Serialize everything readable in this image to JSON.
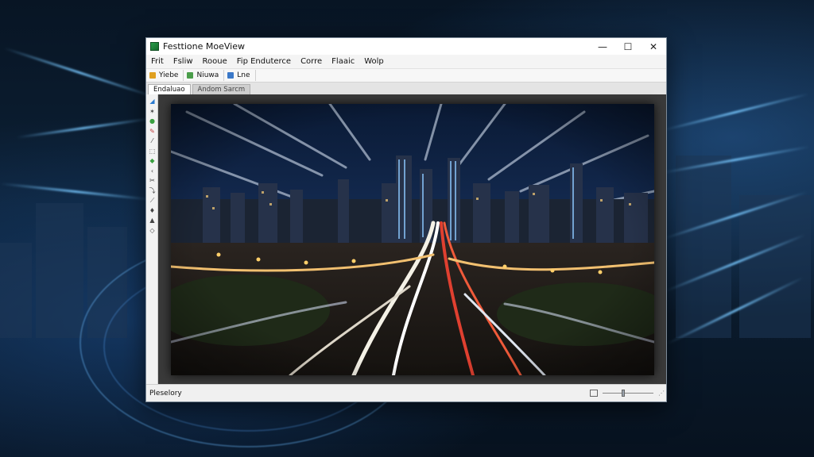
{
  "window": {
    "title": "Festtione MoeView",
    "controls": {
      "minimize": "—",
      "maximize": "☐",
      "close": "✕"
    }
  },
  "menu": [
    "Frit",
    "Fsliw",
    "Rooue",
    "Fip Enduterce",
    "Corre",
    "Flaaic",
    "Wolp"
  ],
  "toolbar": [
    {
      "label": "Yiebe",
      "icon": "folder-icon",
      "color": "#e0a020"
    },
    {
      "label": "Niuwa",
      "icon": "image-icon",
      "color": "#4a9d4a"
    },
    {
      "label": "Lne",
      "icon": "link-icon",
      "color": "#3a78c8"
    }
  ],
  "tabs": [
    {
      "label": "Endaluao",
      "active": true
    },
    {
      "label": "Andom Sarcm",
      "active": false
    }
  ],
  "tool_palette": [
    {
      "icon": "brush-icon",
      "glyph": "◢",
      "color": "#2a7ad0"
    },
    {
      "icon": "wand-icon",
      "glyph": "✶",
      "color": "#444"
    },
    {
      "icon": "color-picker-icon",
      "glyph": "●",
      "color": "#3aa040"
    },
    {
      "icon": "pencil-icon",
      "glyph": "✎",
      "color": "#c04040"
    },
    {
      "icon": "pen-icon",
      "glyph": "⁄",
      "color": "#444"
    },
    {
      "icon": "select-icon",
      "glyph": "⬚",
      "color": "#444"
    },
    {
      "icon": "fill-icon",
      "glyph": "◆",
      "color": "#3aa040"
    },
    {
      "icon": "caret-icon",
      "glyph": "‹",
      "color": "#444"
    },
    {
      "icon": "scissors-icon",
      "glyph": "✂",
      "color": "#444"
    },
    {
      "icon": "lasso-icon",
      "glyph": "⤵",
      "color": "#444"
    },
    {
      "icon": "path-icon",
      "glyph": "⟋",
      "color": "#444"
    },
    {
      "icon": "stamp-icon",
      "glyph": "♦",
      "color": "#444"
    },
    {
      "icon": "eraser-icon",
      "glyph": "▲",
      "color": "#444"
    },
    {
      "icon": "smudge-icon",
      "glyph": "◇",
      "color": "#444"
    }
  ],
  "status": {
    "text": "Pleselory",
    "zoom_level": 0.4
  },
  "canvas": {
    "image_subject": "night city highway with light trails",
    "background": "#3a3a3a"
  },
  "accent_colors": {
    "title_bar": "#ffffff",
    "workspace": "#3a3a3a"
  }
}
